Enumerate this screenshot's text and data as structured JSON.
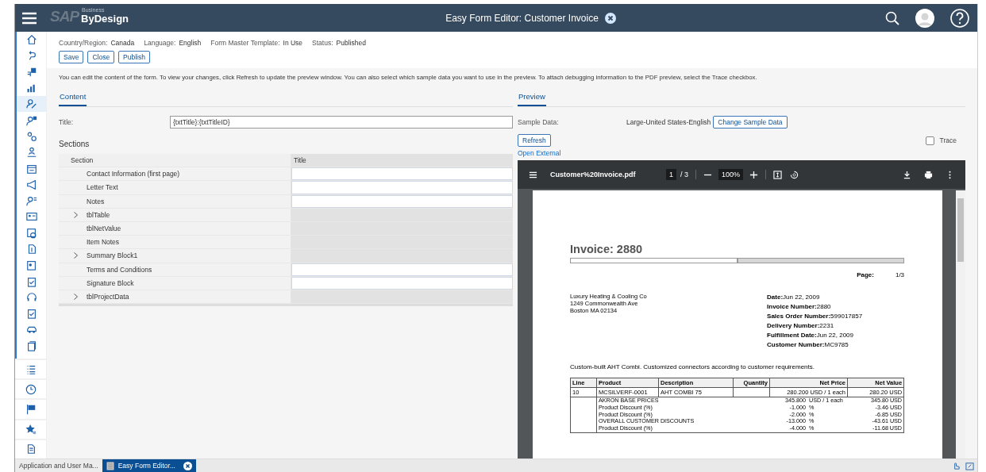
{
  "shell": {
    "logo": {
      "brand": "SAP",
      "tagline": "Business",
      "product": "ByDesign"
    },
    "title": "Easy Form Editor: Customer Invoice"
  },
  "sidebar": {
    "items": [
      {
        "selected": false
      },
      {
        "selected": false
      },
      {
        "selected": false
      },
      {
        "selected": false
      },
      {
        "selected": true
      },
      {
        "selected": false
      },
      {
        "selected": false
      },
      {
        "selected": false
      },
      {
        "selected": false
      },
      {
        "selected": false
      },
      {
        "selected": false
      },
      {
        "selected": false
      },
      {
        "selected": false
      },
      {
        "selected": false
      },
      {
        "selected": false
      },
      {
        "selected": false
      },
      {
        "selected": false
      },
      {
        "selected": false
      },
      {
        "selected": false
      },
      {
        "selected": false
      }
    ]
  },
  "header_info": [
    {
      "label": "Country/Region:",
      "value": "Canada"
    },
    {
      "label": "Language:",
      "value": "English"
    },
    {
      "label": "Form Master Template:",
      "value": "In Use"
    },
    {
      "label": "Status:",
      "value": "Published"
    }
  ],
  "actions": [
    "Save",
    "Close",
    "Publish"
  ],
  "description": "You can edit the content of the form. To view your changes, click Refresh to update the preview window. You can also select which sample data you want to use in the preview. To attach debugging information to the PDF preview, select the Trace checkbox.",
  "content": {
    "tab": {
      "label": "Content",
      "selected": true
    },
    "title_label": "Title:",
    "title_value": "{txtTitle}:{txtTitleID}",
    "sections_heading": "Sections",
    "table": {
      "columns": [
        "Section",
        "Title"
      ],
      "rows": [
        {
          "section": "Contact Information (first page)",
          "expandable": false,
          "title_editable": true
        },
        {
          "section": "Letter Text",
          "expandable": false,
          "title_editable": true
        },
        {
          "section": "Notes",
          "expandable": false,
          "title_editable": true
        },
        {
          "section": "tblTable",
          "expandable": true,
          "title_editable": false
        },
        {
          "section": "tblNetValue",
          "expandable": false,
          "title_editable": false
        },
        {
          "section": "Item Notes",
          "expandable": false,
          "title_editable": false
        },
        {
          "section": "Summary Block1",
          "expandable": true,
          "title_editable": false
        },
        {
          "section": "Terms and Conditions",
          "expandable": false,
          "title_editable": true
        },
        {
          "section": "Signature Block",
          "expandable": false,
          "title_editable": true
        },
        {
          "section": "tblProjectData",
          "expandable": true,
          "title_editable": false
        }
      ]
    }
  },
  "preview": {
    "tab": {
      "label": "Preview",
      "selected": true
    },
    "sample_label": "Sample Data:",
    "sample_value": "Large-United States-English",
    "change_button": "Change Sample Data",
    "refresh_button": "Refresh",
    "trace": {
      "label": "Trace",
      "checked": false
    },
    "open_external": "Open External",
    "viewer": {
      "file_name": "Customer%20Invoice.pdf",
      "page": "1",
      "page_total": "/ 3",
      "zoom": "100%",
      "document": {
        "title": "Invoice: 2880",
        "page_label": "Page:",
        "page_value": "1/3",
        "address": [
          "Luxury Heating & Cooling Co",
          "1249 Commonwealth Ave",
          "Boston MA  02134"
        ],
        "details": [
          "**Date:**Jun 22, 2009",
          "**Invoice Number:**2880",
          "**Sales Order Number:**599017857",
          "**Delivery Number:**2231",
          "**Fulfillment Date:**Jun 22, 2009",
          "**Customer Number:**MC9785"
        ],
        "note": "Custom-built AHT Combi. Customized connectors according to customer requirements.",
        "columns": [
          "Line",
          "Product",
          "Description",
          "Quantity",
          "Net Price",
          "Net Value"
        ],
        "item": {
          "line": "10",
          "product": "MCSILVERF-0001",
          "description": "AHT COMBI 75",
          "net_price": "280.200 USD / 1 each",
          "net_value": "280.20 USD"
        },
        "conditions": [
          {
            "name": "AKRON BASE PRICES",
            "amount": "345.800",
            "unit": "USD / 1 each",
            "value": "345.80 USD"
          },
          {
            "name": "Product Discount (%)",
            "amount": "-1.000",
            "unit": "%",
            "value": "-3.46 USD"
          },
          {
            "name": "Product Discount (%)",
            "amount": "-2.000",
            "unit": "%",
            "value": "-6.85 USD"
          },
          {
            "name": "OVERALL CUSTOMER DISCOUNTS",
            "amount": "-13.000",
            "unit": "%",
            "value": "-43.61 USD"
          },
          {
            "name": "Product Discount (%)",
            "amount": "-4.000",
            "unit": "%",
            "value": "-11.68 USD"
          }
        ]
      }
    }
  },
  "taskbar": {
    "tabs": [
      {
        "label": "Application and User Ma...",
        "selected": false
      },
      {
        "label": "Easy Form Editor...",
        "selected": true
      }
    ]
  }
}
